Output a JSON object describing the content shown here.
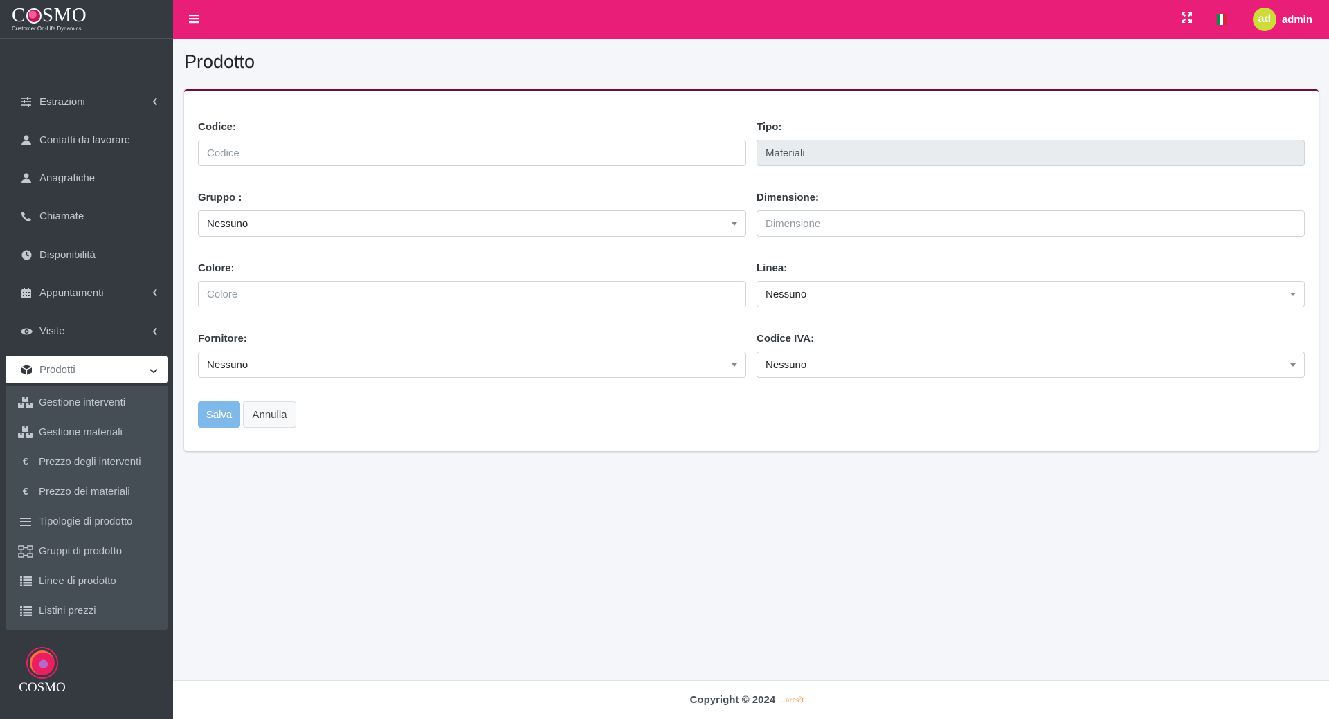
{
  "brand": {
    "title_pre": "C",
    "title_post": "SMO",
    "subtitle": "Customer On-Life Dynamics"
  },
  "sidebar": {
    "items": [
      {
        "label": "Estrazioni",
        "icon": "sliders-icon",
        "has_chevron": true
      },
      {
        "label": "Contatti da lavorare",
        "icon": "user-icon"
      },
      {
        "label": "Anagrafiche",
        "icon": "user-icon"
      },
      {
        "label": "Chiamate",
        "icon": "phone-icon"
      },
      {
        "label": "Disponibilità",
        "icon": "clock-icon"
      },
      {
        "label": "Appuntamenti",
        "icon": "calendar-icon",
        "has_chevron": true
      },
      {
        "label": "Visite",
        "icon": "eye-icon",
        "has_chevron": true
      },
      {
        "label": "Prodotti",
        "icon": "box-icon",
        "active": true
      }
    ],
    "submenu": [
      {
        "label": "Gestione interventi",
        "icon": "boxes-icon"
      },
      {
        "label": "Gestione materiali",
        "icon": "boxes-icon"
      },
      {
        "label": "Prezzo degli interventi",
        "icon": "euro-icon"
      },
      {
        "label": "Prezzo dei materiali",
        "icon": "euro-icon"
      },
      {
        "label": "Tipologie di prodotto",
        "icon": "bars-icon"
      },
      {
        "label": "Gruppi di prodotto",
        "icon": "sitemap-icon"
      },
      {
        "label": "Linee di prodotto",
        "icon": "list-icon"
      },
      {
        "label": "Listini prezzi",
        "icon": "list-icon"
      }
    ],
    "footer_logo_text": "COSMO"
  },
  "header": {
    "user": {
      "initials": "ad",
      "name": "admin"
    },
    "colors": {
      "bar": "#e91e78",
      "avatar": "#cddc39"
    }
  },
  "page": {
    "title": "Prodotto"
  },
  "form": {
    "codice": {
      "label": "Codice:",
      "placeholder": "Codice"
    },
    "tipo": {
      "label": "Tipo:",
      "value": "Materiali"
    },
    "gruppo": {
      "label": "Gruppo :",
      "value": "Nessuno"
    },
    "dimensione": {
      "label": "Dimensione:",
      "placeholder": "Dimensione"
    },
    "colore": {
      "label": "Colore:",
      "placeholder": "Colore"
    },
    "linea": {
      "label": "Linea:",
      "value": "Nessuno"
    },
    "fornitore": {
      "label": "Fornitore:",
      "value": "Nessuno"
    },
    "codice_iva": {
      "label": "Codice IVA:",
      "value": "Nessuno"
    },
    "save_label": "Salva",
    "cancel_label": "Annulla"
  },
  "footer": {
    "copyright": "Copyright © 2024",
    "logo_text": "...ares²t···"
  }
}
